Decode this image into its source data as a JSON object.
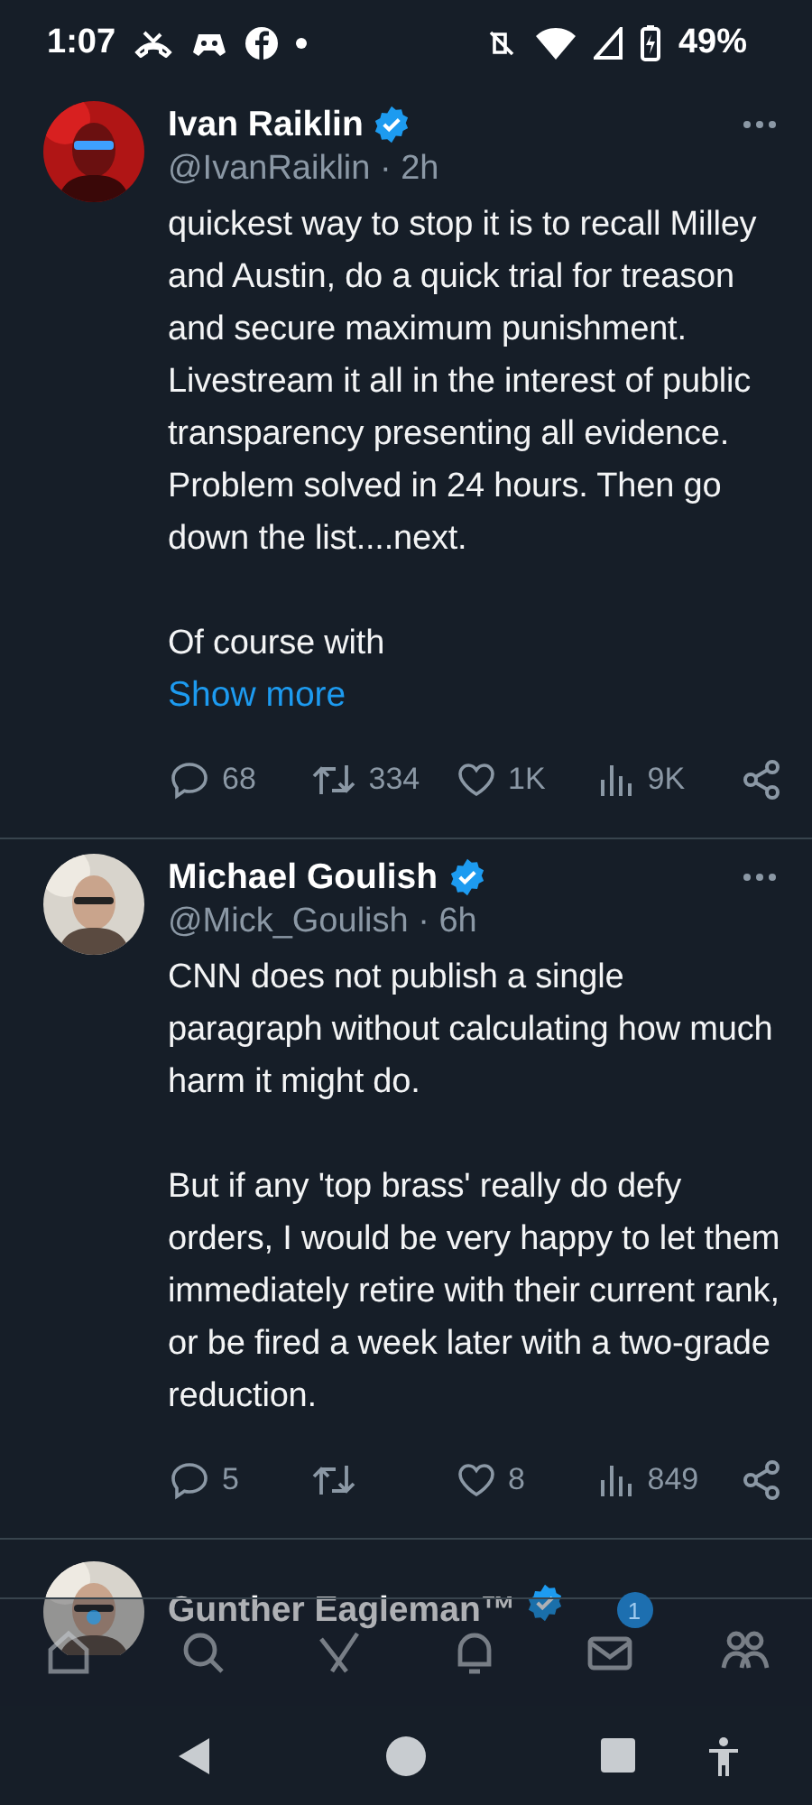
{
  "status_bar": {
    "time": "1:07",
    "battery": "49%"
  },
  "tweets": [
    {
      "name": "Ivan Raiklin",
      "verified": true,
      "handle": "@IvanRaiklin · 2h",
      "avatar": {
        "kind": "picture"
      },
      "body": [
        "quickest way to stop it is to recall Milley and Austin, do a quick trial for treason and secure maximum punishment.  Livestream it all in the interest of public transparency presenting all evidence.  Problem solved in 24 hours.  Then go down the list....next.",
        "Of course with"
      ],
      "show_more": "Show more",
      "actions": [
        {
          "kind": "reply",
          "count": "68"
        },
        {
          "kind": "repost",
          "count": "334"
        },
        {
          "kind": "like",
          "count": "1K"
        },
        {
          "kind": "views",
          "count": "9K"
        },
        {
          "kind": "share"
        }
      ]
    },
    {
      "name": "Michael Goulish",
      "verified": true,
      "handle": "@Mick_Goulish · 6h",
      "avatar": {
        "kind": "picture"
      },
      "body": [
        "CNN does not publish a single paragraph without calculating how much harm it might do.",
        "But if any 'top brass' really do defy orders, I would be very happy to let them immediately retire with their current rank, or be fired a week later with a two-grade reduction."
      ],
      "actions": [
        {
          "kind": "reply",
          "count": "5"
        },
        {
          "kind": "repost"
        },
        {
          "kind": "like",
          "count": "8"
        },
        {
          "kind": "views",
          "count": "849"
        },
        {
          "kind": "share"
        }
      ]
    }
  ],
  "partial_tweet": {
    "name": "Gunther Eagleman™",
    "verified": true
  },
  "tab_bar": [
    {
      "kind": "home",
      "dot": true
    },
    {
      "kind": "search"
    },
    {
      "kind": "grok"
    },
    {
      "kind": "notifications"
    },
    {
      "kind": "messages",
      "badge": "1"
    },
    {
      "kind": "communities"
    }
  ]
}
